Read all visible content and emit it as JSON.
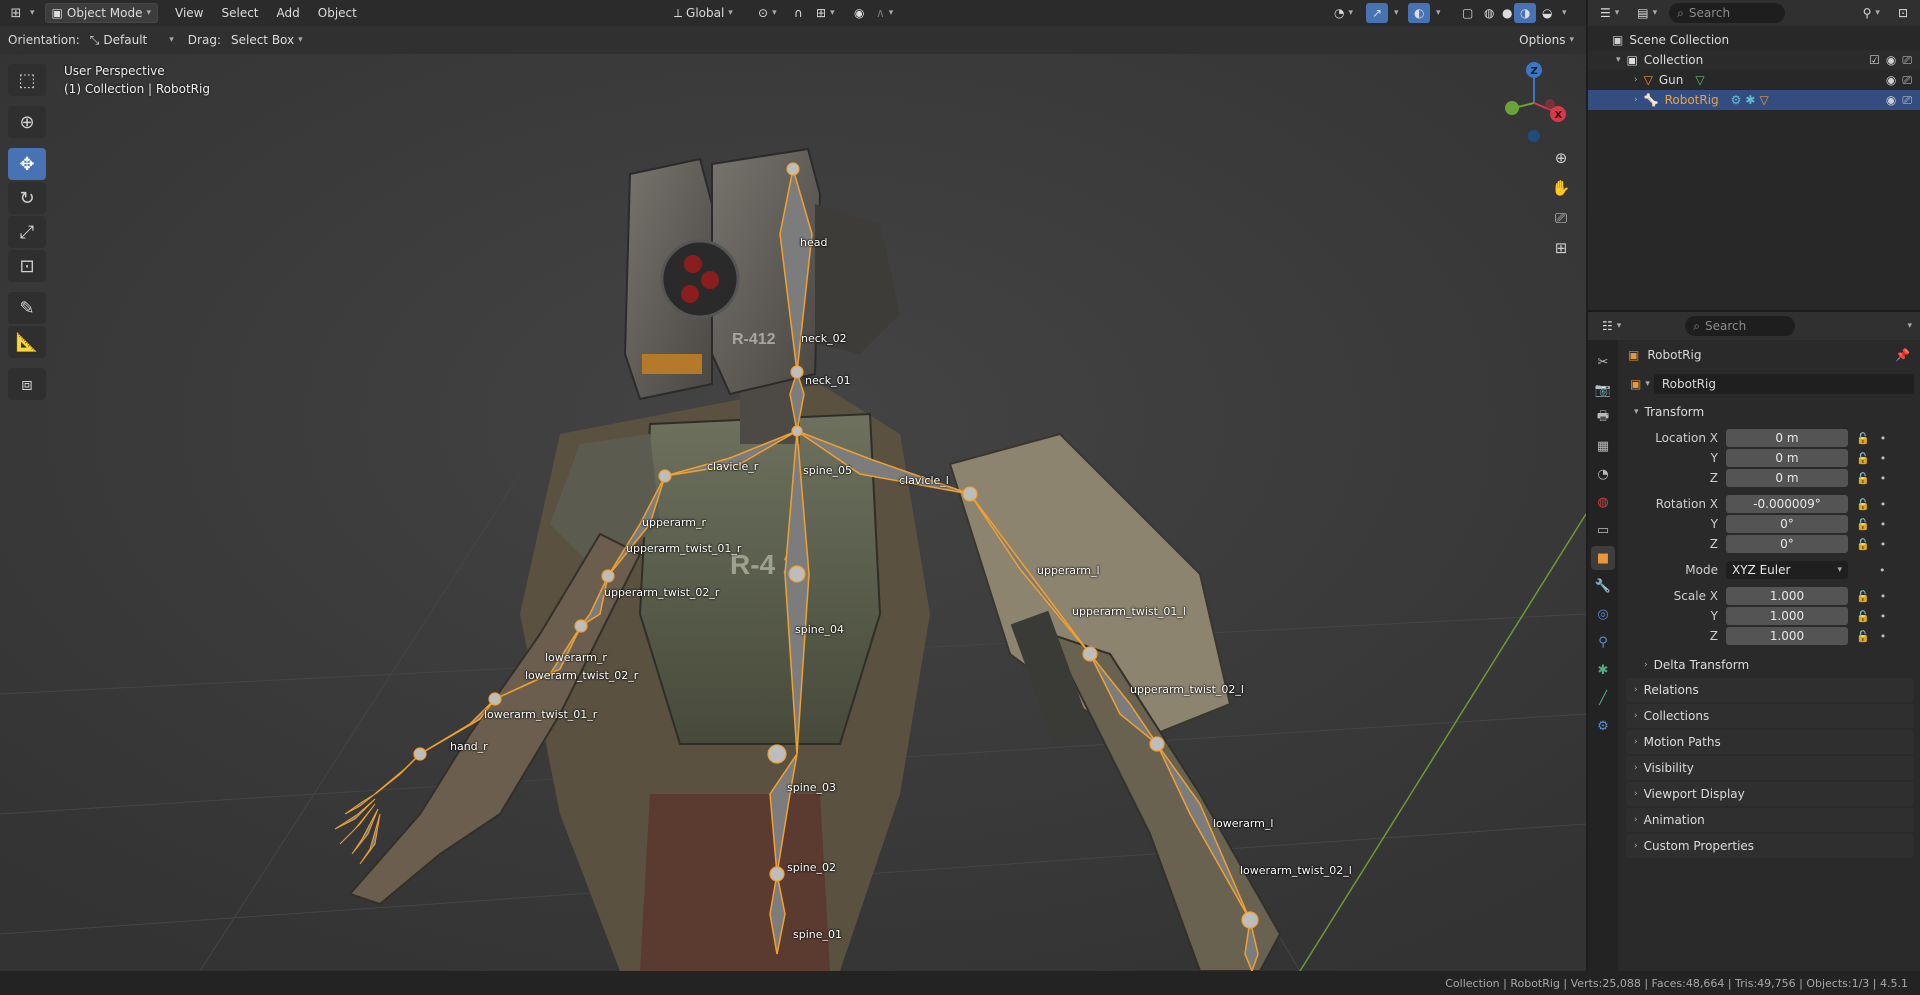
{
  "viewport": {
    "header": {
      "mode": "Object Mode",
      "menus": [
        "View",
        "Select",
        "Add",
        "Object"
      ],
      "transform_orientation": "Global"
    },
    "tool_settings": {
      "orientation_label": "Orientation:",
      "orientation_value": "Default",
      "drag_label": "Drag:",
      "drag_value": "Select Box",
      "options": "Options"
    },
    "overlay": {
      "view_name": "User Perspective",
      "context": "(1) Collection | RobotRig"
    },
    "gizmo": {
      "z": "Z",
      "x": "X"
    },
    "bones": [
      "head",
      "neck_02",
      "neck_01",
      "spine_05",
      "clavicle_r",
      "clavicle_l",
      "upperarm_r",
      "upperarm_twist_01_r",
      "upperarm_twist_02_r",
      "upperarm_l",
      "upperarm_twist_01_l",
      "spine_04",
      "lowerarm_r",
      "lowerarm_twist_02_r",
      "lowerarm_twist_01_r",
      "hand_r",
      "upperarm_twist_02_l",
      "spine_03",
      "lowerarm_l",
      "spine_02",
      "lowerarm_twist_02_l",
      "spine_01"
    ],
    "model_text": {
      "head_plate": "R-412",
      "chest_plate": "R-4 2"
    },
    "colors": {
      "bone_outline": "#f0a030",
      "selection_blue": "#4772b3"
    }
  },
  "outliner": {
    "search_placeholder": "Search",
    "items": [
      {
        "label": "Scene Collection"
      },
      {
        "label": "Collection"
      },
      {
        "label": "Gun"
      },
      {
        "label": "RobotRig"
      }
    ]
  },
  "properties": {
    "search_placeholder": "Search",
    "object_name": "RobotRig",
    "object_name_field": "RobotRig",
    "transform": {
      "title": "Transform",
      "location_x_label": "Location X",
      "location_x": "0 m",
      "location_y_label": "Y",
      "location_y": "0 m",
      "location_z_label": "Z",
      "location_z": "0 m",
      "rotation_x_label": "Rotation X",
      "rotation_x": "-0.000009°",
      "rotation_y_label": "Y",
      "rotation_y": "0°",
      "rotation_z_label": "Z",
      "rotation_z": "0°",
      "mode_label": "Mode",
      "mode": "XYZ Euler",
      "scale_x_label": "Scale X",
      "scale_x": "1.000",
      "scale_y_label": "Y",
      "scale_y": "1.000",
      "scale_z_label": "Z",
      "scale_z": "1.000",
      "delta": "Delta Transform"
    },
    "panels": [
      "Relations",
      "Collections",
      "Motion Paths",
      "Visibility",
      "Viewport Display",
      "Animation",
      "Custom Properties"
    ]
  },
  "status_bar": {
    "text": "Collection | RobotRig | Verts:25,088 | Faces:48,664 | Tris:49,756 | Objects:1/3 | 4.5.1"
  }
}
